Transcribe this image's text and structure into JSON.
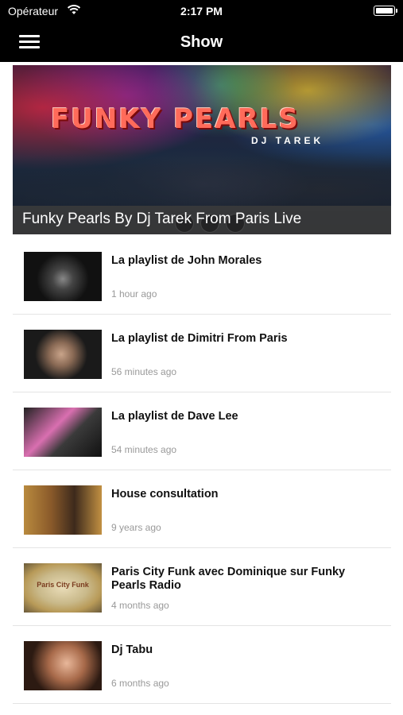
{
  "status_bar": {
    "carrier": "Opérateur",
    "time": "2:17 PM"
  },
  "nav": {
    "title": "Show"
  },
  "hero": {
    "logo_text": "FUNKY PEARLS",
    "logo_sub": "DJ TAREK",
    "caption": "Funky Pearls By Dj Tarek From Paris Live"
  },
  "list": [
    {
      "title": "La playlist de John Morales",
      "time": "1 hour ago"
    },
    {
      "title": "La playlist de Dimitri From Paris",
      "time": "56 minutes ago"
    },
    {
      "title": "La playlist de Dave Lee",
      "time": "54 minutes ago"
    },
    {
      "title": "House consultation",
      "time": "9 years ago"
    },
    {
      "title": "Paris City Funk avec Dominique sur Funky Pearls Radio",
      "time": "4 months ago",
      "thumb_text": "Paris City Funk"
    },
    {
      "title": "Dj Tabu",
      "time": "6 months ago"
    }
  ]
}
